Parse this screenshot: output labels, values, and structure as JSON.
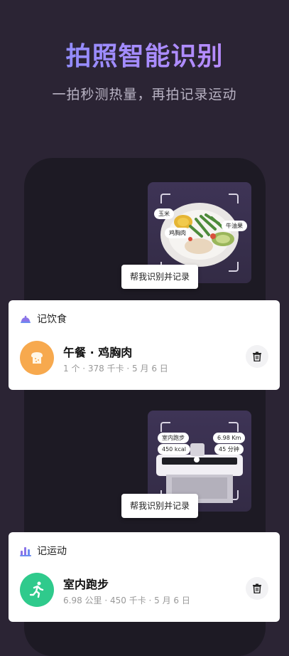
{
  "header": {
    "title": "拍照智能识别",
    "subtitle": "一拍秒测热量，再拍记录运动"
  },
  "food_photo": {
    "tags": [
      "玉米",
      "鸡胸肉",
      "牛油果"
    ],
    "button": "帮我识别并记录"
  },
  "food_card": {
    "header_label": "记饮食",
    "title": "午餐 · 鸡胸肉",
    "meta": "1 个 · 378 千卡 · 5 月 6 日",
    "icons": {
      "header": "food-cover-icon",
      "avatar": "bread-icon",
      "delete": "trash-icon"
    },
    "colors": {
      "avatar": "#f7a94e"
    }
  },
  "exercise_photo": {
    "tags": [
      "室内跑步",
      "6.98 Km",
      "450 kcal",
      "45 分钟"
    ],
    "button": "帮我识别并记录"
  },
  "exercise_card": {
    "header_label": "记运动",
    "title": "室内跑步",
    "meta": "6.98 公里 · 450 千卡 · 5 月 6 日",
    "icons": {
      "header": "bar-chart-icon",
      "avatar": "running-icon",
      "delete": "trash-icon"
    },
    "colors": {
      "avatar": "#2fca8c"
    }
  }
}
